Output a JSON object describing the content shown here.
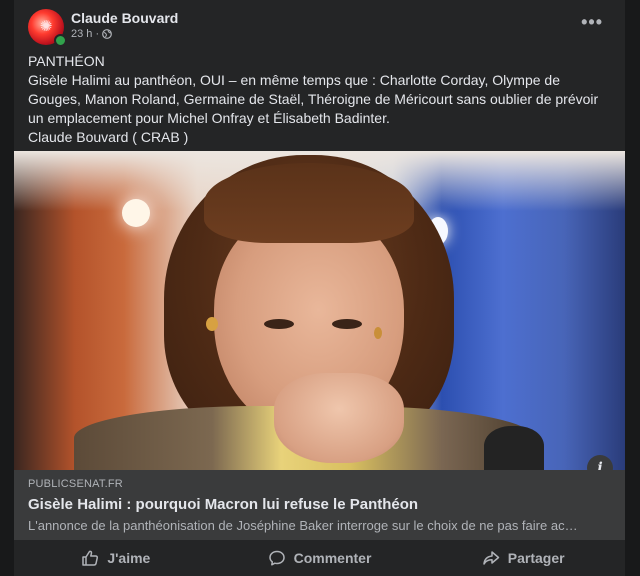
{
  "post": {
    "author": "Claude Bouvard",
    "time": "23 h ·",
    "more_label": "•••",
    "text": "PANTHÉON\nGisèle Halimi au panthéon, OUI – en même temps que : Charlotte Corday, Olympe de Gouges, Manon Roland, Germaine de Staël, Théroigne de Méricourt sans oublier de prévoir un emplacement pour Michel Onfray et Élisabeth Badinter.\nClaude Bouvard ( CRAB )"
  },
  "link": {
    "domain": "PUBLICSENAT.FR",
    "title": "Gisèle Halimi : pourquoi Macron lui refuse le Panthéon",
    "description": "L'annonce de la panthéonisation de Joséphine Baker interroge sur le choix de ne pas faire ac…",
    "info_label": "i"
  },
  "actions": {
    "like": "J'aime",
    "comment": "Commenter",
    "share": "Partager"
  }
}
